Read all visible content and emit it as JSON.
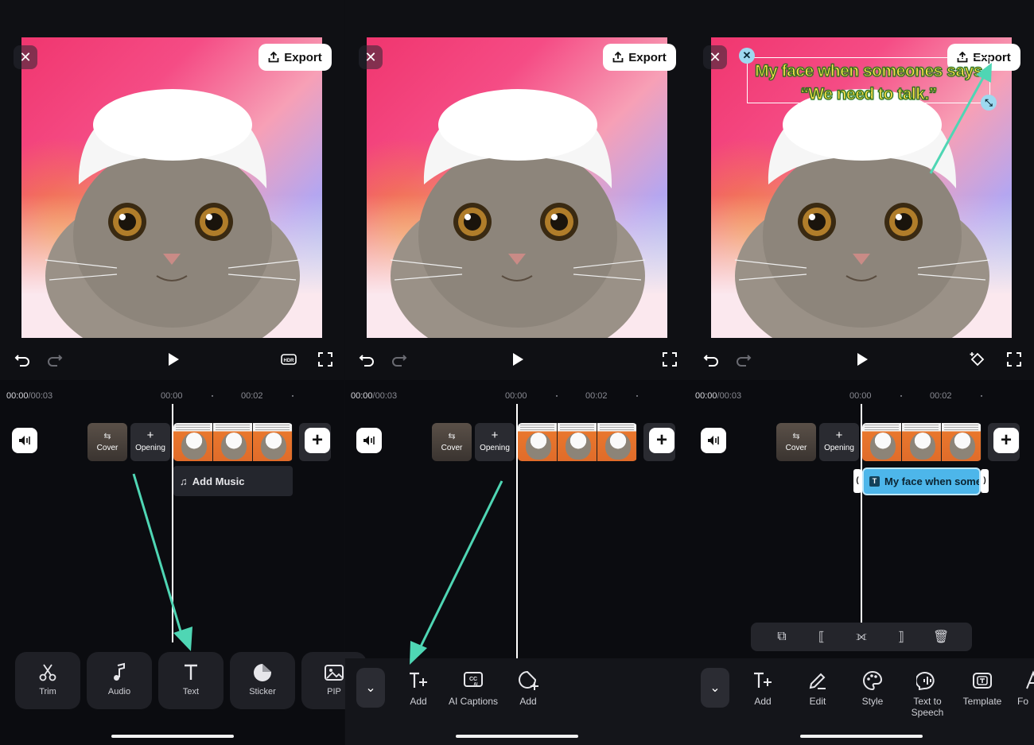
{
  "export_label": "Export",
  "caption": {
    "line1": "My face when someones says",
    "line2": "“We need to talk.”"
  },
  "timeline": {
    "current": "00:00",
    "total": "/00:03",
    "tick0": "00:00",
    "tick2": "00:02"
  },
  "tiles": {
    "cover": "Cover",
    "opening": "Opening"
  },
  "add_music": "Add Music",
  "text_track_label": "My face when someones says",
  "panel1_tools": [
    "Trim",
    "Audio",
    "Text",
    "Sticker",
    "PIP"
  ],
  "panel2_tools": {
    "add": "Add",
    "ai_captions": "AI Captions",
    "add2": "Add"
  },
  "panel3_tools": [
    "Add",
    "Edit",
    "Style",
    "Text to Speech",
    "Template",
    "Fo"
  ],
  "colors": {
    "accent_arrow": "#4fd6b4",
    "text_track": "#4db6ea"
  },
  "icons": [
    "close-icon",
    "upload-icon",
    "undo-icon",
    "redo-icon",
    "play-icon",
    "hdr-icon",
    "fullscreen-icon",
    "keyframe-icon",
    "volume-icon",
    "plus-icon",
    "music-icon",
    "scissors-icon",
    "note-icon",
    "text-icon",
    "sticker-icon",
    "pip-icon",
    "chevron-down-icon",
    "text-add-icon",
    "cc-ai-icon",
    "sticker-add-icon",
    "pencil-icon",
    "palette-icon",
    "text-to-speech-icon",
    "template-icon",
    "copy-icon",
    "split-icon",
    "delete-icon"
  ]
}
